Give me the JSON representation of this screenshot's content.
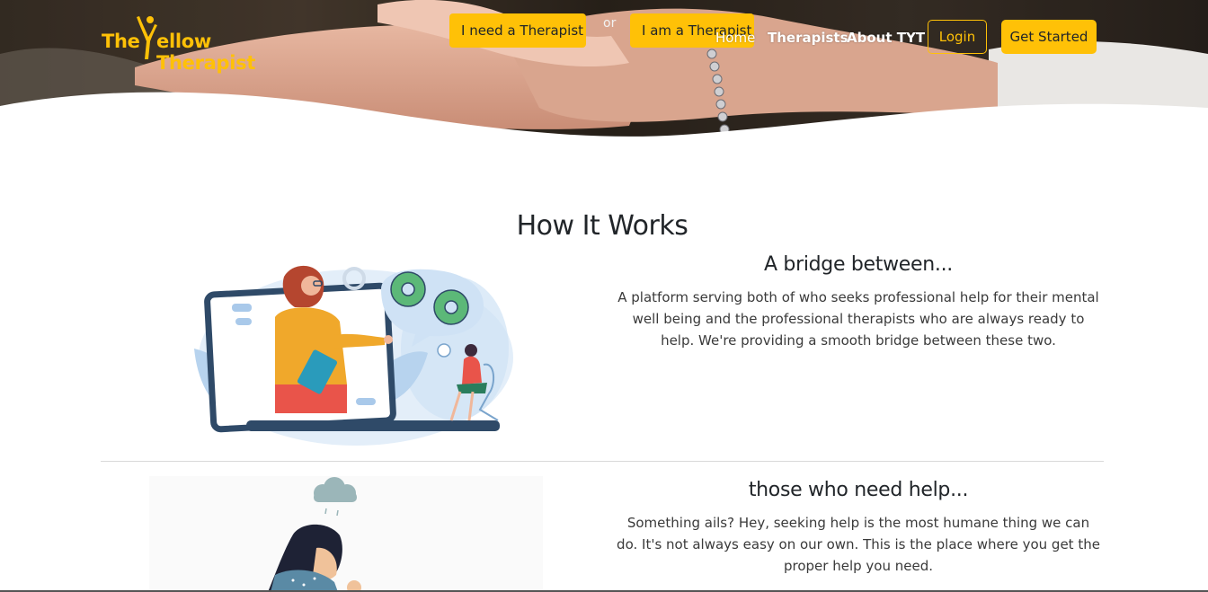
{
  "brand": {
    "logo_prefix": "The",
    "logo_suffix": "ellow Therapist",
    "color_primary": "#ffc107",
    "color_text": "#212529"
  },
  "hero": {
    "need_therapist_label": "I need a Therapist",
    "or_label": "or",
    "am_therapist_label": "I am a Therapist"
  },
  "nav": {
    "home": "Home",
    "therapists": "Therapists",
    "about": "About TYT",
    "login": "Login",
    "get_started": "Get Started"
  },
  "how_it_works": {
    "title": "How It Works",
    "items": [
      {
        "heading": "A bridge between...",
        "text": "A platform serving both of who seeks professional help for their mental well being and the professional therapists who are always ready to help. We're providing a smooth bridge between these two."
      },
      {
        "heading": "those who need help...",
        "text": "Something ails? Hey, seeking help is the most humane thing we can do. It's not always easy on our own. This is the place where you get the proper help you need."
      }
    ]
  },
  "icons": [
    "logo-figure-icon",
    "gear-icon",
    "chat-bubble-icon",
    "phone-icon",
    "cloud-icon",
    "rain-icon",
    "clipboard-icon"
  ]
}
